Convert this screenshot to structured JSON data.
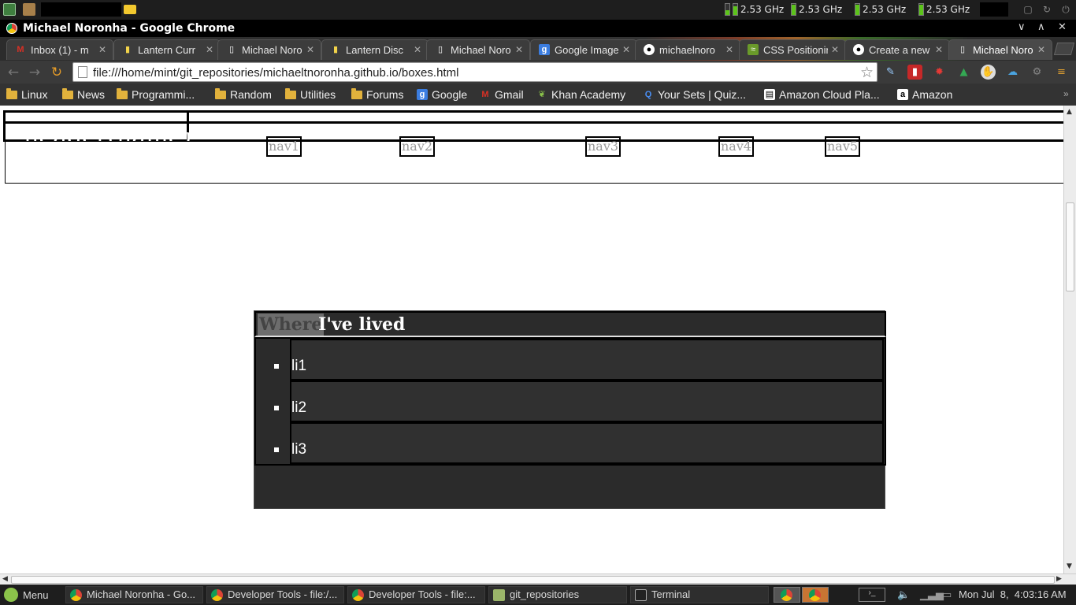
{
  "system_panel": {
    "cpu_freqs": [
      "2.53 GHz",
      "2.53 GHz",
      "2.53 GHz",
      "2.53 GHz"
    ]
  },
  "window": {
    "title": "Michael Noronha - Google Chrome",
    "controls": [
      "∨",
      "∧",
      "✕"
    ]
  },
  "tabs": [
    {
      "label": "Inbox (1) - m",
      "icon": "gmail-icon"
    },
    {
      "label": "Lantern Curr",
      "icon": "lantern-icon"
    },
    {
      "label": "Michael Noro",
      "icon": "page-icon"
    },
    {
      "label": "Lantern Disc",
      "icon": "lantern-icon"
    },
    {
      "label": "Michael Noro",
      "icon": "page-icon"
    },
    {
      "label": "Google Image",
      "icon": "google-icon"
    },
    {
      "label": "michaelnoro",
      "icon": "github-icon"
    },
    {
      "label": "CSS Positionin",
      "icon": "css-icon"
    },
    {
      "label": "Create a new",
      "icon": "github-icon"
    },
    {
      "label": "Michael Noro",
      "icon": "page-icon"
    }
  ],
  "toolbar": {
    "url": "file:///home/mint/git_repositories/michaeltnoronha.github.io/boxes.html"
  },
  "bookmarks": [
    {
      "label": "Linux",
      "icon": "folder"
    },
    {
      "label": "News",
      "icon": "folder"
    },
    {
      "label": "Programmi...",
      "icon": "folder"
    },
    {
      "label": "Random",
      "icon": "folder"
    },
    {
      "label": "Utilities",
      "icon": "folder"
    },
    {
      "label": "Forums",
      "icon": "folder"
    },
    {
      "label": "Google",
      "icon": "google"
    },
    {
      "label": "Gmail",
      "icon": "gmail"
    },
    {
      "label": "Khan Academy",
      "icon": "khan"
    },
    {
      "label": "Your Sets | Quiz...",
      "icon": "quizlet"
    },
    {
      "label": "Amazon Cloud Pla...",
      "icon": "amazon-cloud"
    },
    {
      "label": "Amazon",
      "icon": "amazon"
    }
  ],
  "page": {
    "header_text": "header(name)",
    "nav": [
      "nav1",
      "nav2",
      "nav3",
      "nav4",
      "nav5"
    ],
    "lived_heading_highlight": "Where",
    "lived_heading_rest": "I've lived",
    "list_items": [
      "li1",
      "li2",
      "li3"
    ]
  },
  "taskbar": {
    "menu_label": "Menu",
    "tasks": [
      "Michael Noronha - Go...",
      "Developer Tools - file:/...",
      "Developer Tools - file:...",
      "git_repositories",
      "Terminal"
    ],
    "clock": "Mon Jul  8,  4:03:16 AM"
  },
  "colors": {
    "panel": "#1e1e1e",
    "lived_bg": "#2b2b2b",
    "cpu_bar": "#5cc41a",
    "folder": "#e2b23c"
  }
}
